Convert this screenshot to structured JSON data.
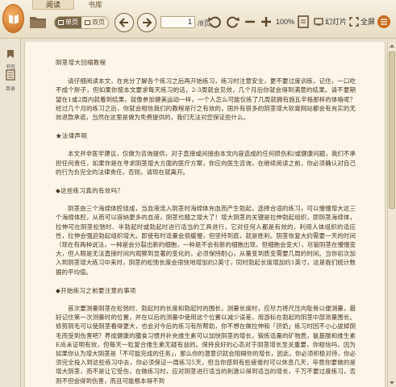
{
  "colors": {
    "accent": "#c86a1c",
    "page_bg": "#fbf6e9",
    "chrome_bg": "#e8dcc2",
    "text": "#4a3520"
  },
  "tabs": [
    {
      "label": "阅读",
      "active": true
    },
    {
      "label": "书库",
      "active": false
    }
  ],
  "toolbar": {
    "single_page": "单页",
    "double_page": "双页",
    "page_current": "1",
    "page_total": "/8页",
    "zoom": "100%",
    "slideshow": "幻灯片",
    "fullscreen": "全屏",
    "icons": [
      "folder-icon",
      "back-icon",
      "forward-icon",
      "rotate-left-icon",
      "rotate-right-icon",
      "zoom-out-icon",
      "zoom-in-icon",
      "fit-icon"
    ]
  },
  "sidebar": {
    "items": [
      {
        "label": "书签",
        "icon": "bookmark-icon"
      },
      {
        "label": "目录",
        "icon": "toc-icon"
      }
    ]
  },
  "document": {
    "title": "阴茎增大回缩教程",
    "intro": "请仔细阅读本文，在充分了解各个练习之后再开始练习，练习时注意安全，更不要过度训练，记住，一口吃不成个胖子，但如果你按本文要求每天练习的话，2-3周就会见效，几个月后你就会得到满意的结果。请不要期望在1或2周内就看到结果，就像参加健美运动一样，一个人怎么可能仅练了几周就拥有施瓦辛格那样的体格呢？经过几个月的练习之后，你就会相信我们的教程是行之有效的，国外有很多的阴茎增大软膏网站都会有充实的无效退款承诺，当然在这里是做为免费提供的，我们无法对您保证些什么。",
    "h_legal": "★法律声明",
    "legal": "本文并非医学建议，仅做为咨询提供，对于直接或间接由本文内容造成的任何损伤和/或健康问题，我们不承担任何责任，如果你是在寻求阴茎增大方面的医疗方案，你应向医生咨询，在继续阅读之前，你必须确认对自己的行为负完全的法律责任，否则，请现在就离开。",
    "h_why": "◆这些练习真的有效吗？",
    "why": "阴茎由三个海绵体腔组成，当血液流入阴茎时海绵体充血而产生勃起，选择合适的练习，可以慢慢增大这三个海绵体腔，从而可以容纳更多的血液，阴茎也随之增大了！增大阴茎的关键是拉伸勃起组织，即阴茎海绵体，拉伸可在阴茎松弛时、半勃起时或勃起时进行适当的工具进行，它对任何人都是有效的，利用人体组织的适应性，拉伸会强迫勃起组织增大。即使有时适量会很缓慢，但坚持到底，就是胜利。阴茎恢复大约需要一天的时间（现在有两种说法，一种是会分裂出新的细胞，一种是不会有新的细胞出现，但细胞会变大），尽管阴茎在慢慢变大，但人眼是无法直接时间内观察到显著的变化的，必须保持耐心，从量变到质变需要几周的时间。当你初次加入到阴茎增大练习中来时，阴茎的松弛长度会很快地增加约2英寸，同时勃起长度增加约1英寸，这是我们统计数据的平均值。",
    "h_before": "◆开始练习之前要注意的事项",
    "before": "首次要测量阴茎在松弛时、勃起时的长度和勃起时的围长，测量长度时，应尽力将尺压向耻骨以便测量，最好记住第一次测量时的位置，并在以后的测量中使用这个位置以减少误差，用游标在勃起的阴茎中部测量围长。修剪阴毛可以使阴茎看得更大，也会对今后的练习有所帮助，你不想在做拉伸和「挤奶」练习时因不小心拔掉阴毛而受到伤害吧？养成健康的膳食习惯并补充维生素可以加快阴茎的增长，锻炼适量的矿物质，氨基酸和维生素E尚未证明有效，但每天一粒复合维生素无疑有益的。保持良好的心态对于阴茎增长至关重要，你相信吗，因为如果你认为增大阴茎是「不可能完成的任务」，那么你的潜意识就会阻碍你的增长，因此，你必须积极对待，你必须完全投入到这些练习中去，你必须保证一周练习5天，但当你感到有些疲倦时可以休息几天，毕竟你要做的是增大阴茎，而不是让它受伤，在做练习时，应对阴茎进行适当的刺激以得到适当的增长，千万不要过度练习，否则不但会得到伤害，而且可能根本得不到"
  }
}
